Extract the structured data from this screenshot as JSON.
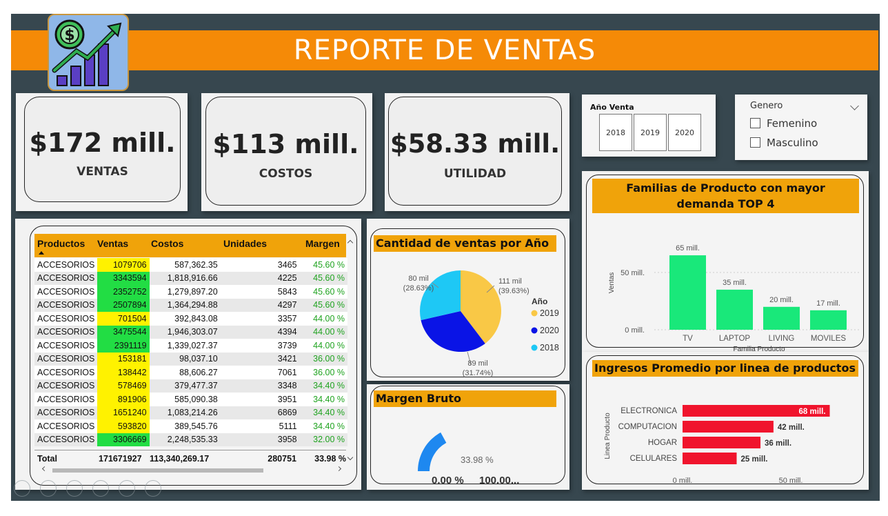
{
  "header": {
    "title": "REPORTE DE VENTAS",
    "logo_icon": "sales-growth-icon"
  },
  "kpis": [
    {
      "value": "$172 mill.",
      "label": "VENTAS"
    },
    {
      "value": "$113 mill.",
      "label": "COSTOS"
    },
    {
      "value": "$58.33 mill.",
      "label": "UTILIDAD"
    }
  ],
  "year_slicer": {
    "title": "Año Venta",
    "options": [
      "2018",
      "2019",
      "2020"
    ]
  },
  "gender_slicer": {
    "title": "Genero",
    "options": [
      "Femenino",
      "Masculino"
    ]
  },
  "table": {
    "headers": [
      "Productos",
      "Ventas",
      "Costos",
      "Unidades",
      "Margen"
    ],
    "rows": [
      [
        "ACCESORIOS",
        "1079706",
        "587,362.35",
        "3465",
        "45.60 %"
      ],
      [
        "ACCESORIOS",
        "3343594",
        "1,818,916.66",
        "4225",
        "45.60 %"
      ],
      [
        "ACCESORIOS",
        "2352752",
        "1,279,897.20",
        "5843",
        "45.60 %"
      ],
      [
        "ACCESORIOS",
        "2507894",
        "1,364,294.88",
        "4297",
        "45.60 %"
      ],
      [
        "ACCESORIOS",
        "701504",
        "392,843.08",
        "3357",
        "44.00 %"
      ],
      [
        "ACCESORIOS",
        "3475544",
        "1,946,303.07",
        "4394",
        "44.00 %"
      ],
      [
        "ACCESORIOS",
        "2391119",
        "1,339,027.37",
        "3739",
        "44.00 %"
      ],
      [
        "ACCESORIOS",
        "153181",
        "98,037.10",
        "3421",
        "36.00 %"
      ],
      [
        "ACCESORIOS",
        "138442",
        "88,606.27",
        "7061",
        "36.00 %"
      ],
      [
        "ACCESORIOS",
        "578469",
        "379,477.37",
        "3348",
        "34.40 %"
      ],
      [
        "ACCESORIOS",
        "891906",
        "585,090.38",
        "3951",
        "34.40 %"
      ],
      [
        "ACCESORIOS",
        "1651240",
        "1,083,214.26",
        "6869",
        "34.40 %"
      ],
      [
        "ACCESORIOS",
        "593820",
        "389,545.76",
        "5111",
        "34.40 %"
      ],
      [
        "ACCESORIOS",
        "3306669",
        "2,248,535.33",
        "3958",
        "32.00 %"
      ]
    ],
    "ventas_highlight": [
      "yellow",
      "green",
      "green",
      "green",
      "yellow",
      "green",
      "green",
      "yellow",
      "yellow",
      "yellow",
      "yellow",
      "yellow",
      "yellow",
      "green"
    ],
    "total": [
      "Total",
      "171671927",
      "113,340,269.17",
      "280751",
      "33.98 %"
    ]
  },
  "chart_data": [
    {
      "type": "pie",
      "title": "Cantidad de ventas por Año",
      "legend_title": "Año",
      "legend_position": "right",
      "slices": [
        {
          "name": "2019",
          "value": 111,
          "label": "111 mil",
          "pct": "(39.63%)",
          "color": "#f9c846"
        },
        {
          "name": "2020",
          "value": 89,
          "label": "89 mil",
          "pct": "(31.74%)",
          "color": "#0a14e6"
        },
        {
          "name": "2018",
          "value": 80,
          "label": "80 mil",
          "pct": "(28.63%)",
          "color": "#1ec8f5"
        }
      ]
    },
    {
      "type": "bar",
      "title": "Familias de Producto con mayor demanda TOP 4",
      "categories": [
        "TV",
        "LAPTOP",
        "LIVING",
        "MOVILES"
      ],
      "values": [
        65,
        35,
        20,
        17
      ],
      "value_labels": [
        "65 mill.",
        "35 mill.",
        "20 mill.",
        "17 mill."
      ],
      "xlabel": "Familia Producto",
      "ylabel": "Ventas",
      "ticks": [
        "0 mill.",
        "50 mill."
      ],
      "ylim": [
        0,
        75
      ],
      "color": "#19e87a"
    },
    {
      "type": "bar",
      "orientation": "horizontal",
      "title": "Ingresos Promedio por linea de productos",
      "categories": [
        "ELECTRONICA",
        "COMPUTACION",
        "HOGAR",
        "CELULARES"
      ],
      "values": [
        68,
        42,
        36,
        25
      ],
      "value_labels": [
        "68 mill.",
        "42 mill.",
        "36 mill.",
        "25 mill."
      ],
      "ylabel": "Linea Producto",
      "ticks": [
        "0 mill.",
        "50 mill."
      ],
      "xlim": [
        0,
        68
      ],
      "color": "#f0142d"
    },
    {
      "type": "gauge",
      "title": "Margen Bruto",
      "value": 33.98,
      "value_label": "33.98 %",
      "min_label": "0.00 %",
      "max_label": "100.00...",
      "color": "#1e88f0"
    }
  ],
  "colors": {
    "accent": "#f58a07",
    "background": "#37474f",
    "highlight_yellow": "#fff200",
    "highlight_green": "#22dd44",
    "margin_green": "#1fa31f"
  }
}
